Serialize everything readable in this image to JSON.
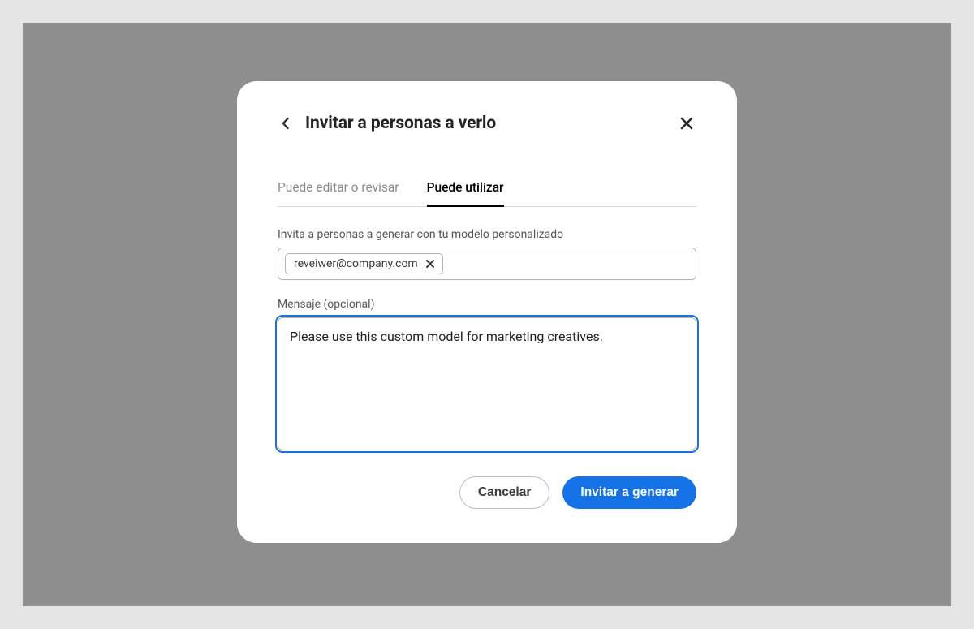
{
  "modal": {
    "title": "Invitar a personas a verlo",
    "tabs": {
      "edit": "Puede editar o revisar",
      "use": "Puede utilizar"
    },
    "invite_label": "Invita a personas a generar con tu modelo personalizado",
    "chip_email": "reveiwer@company.com",
    "message_label": "Mensaje (opcional)",
    "message_value": "Please use this custom model for marketing creatives.",
    "cancel": "Cancelar",
    "submit": "Invitar a generar"
  }
}
